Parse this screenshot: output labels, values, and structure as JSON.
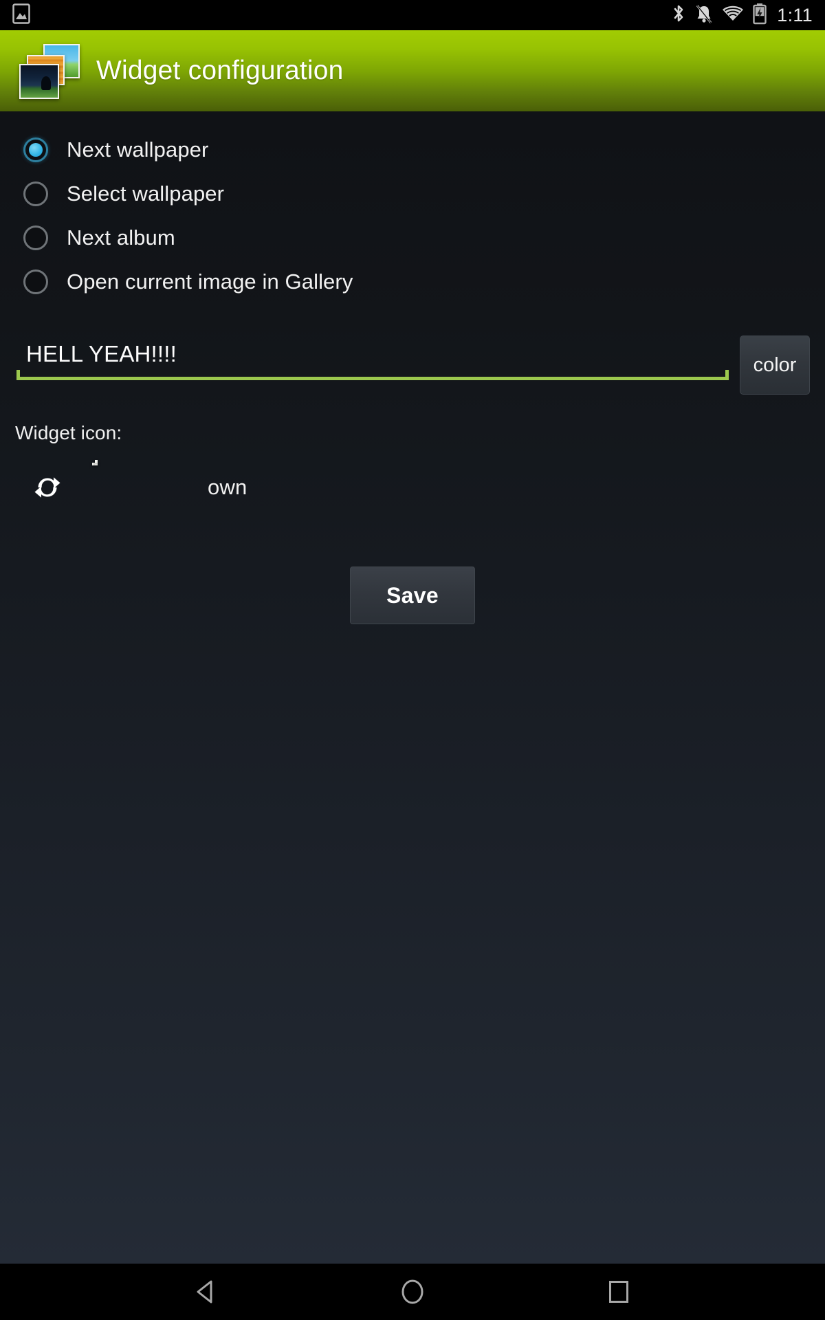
{
  "status_bar": {
    "notification_icon": "image-notification-icon",
    "icons": [
      "bluetooth-icon",
      "notifications-muted-icon",
      "wifi-icon",
      "battery-charging-icon"
    ],
    "clock": "1:11"
  },
  "header": {
    "title": "Widget configuration",
    "icon": "photo-stack-icon",
    "gradient_top": "#a2cc03",
    "gradient_bottom": "#4a5f07"
  },
  "options": {
    "selected_index": 0,
    "accent_color": "#33b5e5",
    "items": [
      {
        "label": "Next wallpaper",
        "checked": true
      },
      {
        "label": "Select wallpaper",
        "checked": false
      },
      {
        "label": "Next album",
        "checked": false
      },
      {
        "label": "Open current image in Gallery",
        "checked": false
      }
    ]
  },
  "label_field": {
    "value": "HELL YEAH!!!!",
    "placeholder": "",
    "underline_color": "#9cc84e",
    "color_button_label": "color"
  },
  "widget_icon": {
    "section_label": "Widget icon:",
    "refresh_icon": "refresh-icon",
    "stack_icon": "photo-stack-icon",
    "own_label": "own"
  },
  "actions": {
    "save_label": "Save"
  },
  "nav_bar": {
    "back": "back-triangle-icon",
    "home": "home-circle-icon",
    "recents": "recents-square-icon"
  }
}
